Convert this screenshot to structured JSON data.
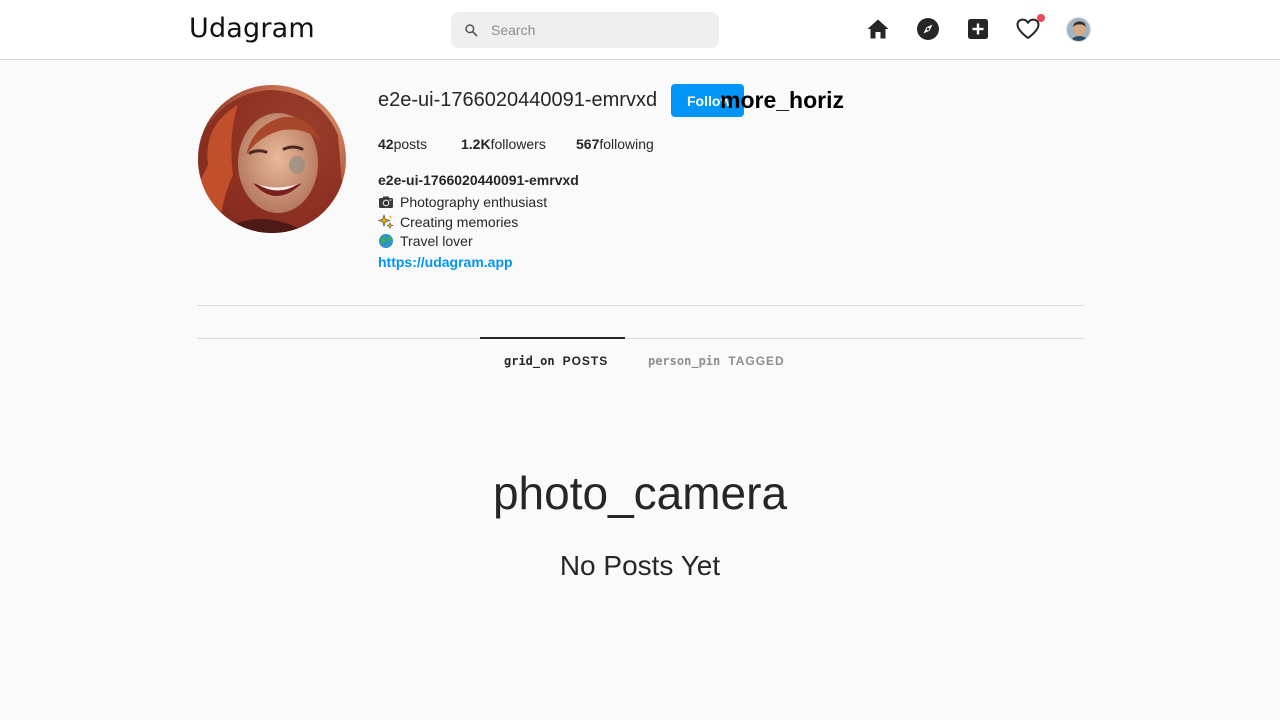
{
  "header": {
    "logo": "Udagram",
    "search": {
      "placeholder": "Search",
      "value": ""
    },
    "nav_icons": [
      "home-icon",
      "explore-icon",
      "add-post-icon",
      "activity-heart-icon",
      "profile-avatar"
    ],
    "notification_color": "#ed4956"
  },
  "profile": {
    "username": "e2e-ui-1766020440091-emrvxd",
    "follow_label": "Follow",
    "more_label": "more_horiz",
    "stats": {
      "posts_count": "42",
      "posts_label": "posts",
      "followers_count": "1.2K",
      "followers_label": "followers",
      "following_count": "567",
      "following_label": "following"
    },
    "bio": {
      "name": "e2e-ui-1766020440091-emrvxd",
      "lines": [
        {
          "icon": "camera-emoji-icon",
          "text": "Photography enthusiast"
        },
        {
          "icon": "sparkles-emoji-icon",
          "text": "Creating memories"
        },
        {
          "icon": "globe-emoji-icon",
          "text": "Travel lover"
        }
      ],
      "link": "https://udagram.app"
    }
  },
  "tabs": [
    {
      "icon_text": "grid_on",
      "label": "POSTS",
      "active": true
    },
    {
      "icon_text": "person_pin",
      "label": "TAGGED",
      "active": false
    }
  ],
  "empty_state": {
    "icon_text": "photo_camera",
    "message": "No Posts Yet"
  },
  "colors": {
    "accent": "#0095f6",
    "border": "#dbdbdb",
    "background": "#fafafa"
  }
}
